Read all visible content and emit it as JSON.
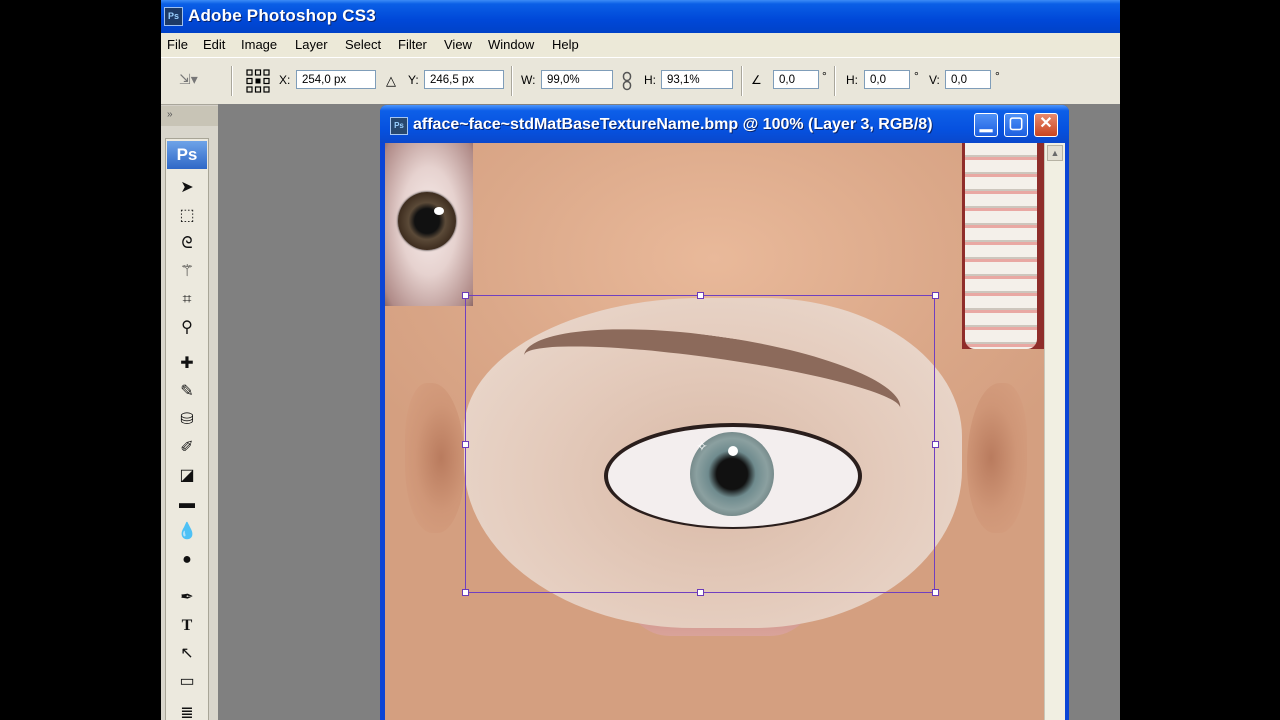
{
  "app": {
    "title": "Adobe Photoshop CS3",
    "icon_text": "Ps"
  },
  "menu": [
    "File",
    "Edit",
    "Image",
    "Layer",
    "Select",
    "Filter",
    "View",
    "Window",
    "Help"
  ],
  "options": {
    "x_label": "X:",
    "x_value": "254,0 px",
    "y_label": "Y:",
    "y_value": "246,5 px",
    "w_label": "W:",
    "w_value": "99,0%",
    "h_label": "H:",
    "h_value": "93,1%",
    "angle_value": "0,0",
    "hskew_label": "H:",
    "hskew_value": "0,0",
    "vskew_label": "V:",
    "vskew_value": "0,0",
    "degree": "°"
  },
  "toolbox": {
    "logo": "Ps",
    "collapse": "»",
    "tools": [
      "move-tool",
      "marquee-tool",
      "lasso-tool",
      "magic-wand-tool",
      "crop-tool",
      "eyedropper-tool",
      "healing-brush-tool",
      "brush-tool",
      "clone-stamp-tool",
      "history-brush-tool",
      "eraser-tool",
      "gradient-tool",
      "blur-tool",
      "dodge-tool",
      "pen-tool",
      "type-tool",
      "path-selection-tool",
      "shape-tool",
      "notes-tool"
    ]
  },
  "document": {
    "title": "afface~face~stdMatBaseTextureName.bmp @ 100% (Layer 3, RGB/8)",
    "icon_text": "Ps"
  },
  "colors": {
    "titlebar": "#0048d8",
    "transform_box": "#7040c0",
    "workspace": "#808080"
  }
}
